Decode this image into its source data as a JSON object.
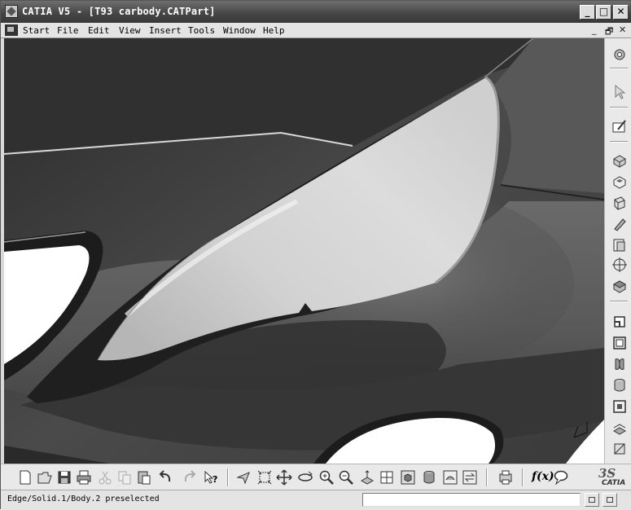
{
  "window": {
    "title": "CATIA V5 - [T93 carbody.CATPart]",
    "controls": {
      "minimize": "_",
      "maximize": "□",
      "close": "✕"
    }
  },
  "menu": {
    "items": [
      {
        "label": "Start",
        "key": "S"
      },
      {
        "label": "File",
        "key": "F"
      },
      {
        "label": "Edit",
        "key": "E"
      },
      {
        "label": "View",
        "key": "V"
      },
      {
        "label": "Insert",
        "key": "I"
      },
      {
        "label": "Tools",
        "key": "T"
      },
      {
        "label": "Window",
        "key": "W"
      },
      {
        "label": "Help",
        "key": "H"
      }
    ],
    "doc_controls": {
      "minimize": "_",
      "restore": "🗗",
      "close": "✕"
    }
  },
  "right_toolbar": {
    "icons": [
      "sketcher-settings-icon",
      "select-arrow-icon",
      "sketcher-icon",
      "pad-icon",
      "pocket-icon",
      "shaft-icon",
      "rib-icon",
      "hole-icon",
      "stiffener-icon",
      "fillet-icon",
      "chamfer-icon",
      "draft-icon",
      "shell-icon",
      "mirror-icon",
      "pattern-icon",
      "thickness-icon",
      "boolean-icon",
      "measure-icon"
    ]
  },
  "bottom_toolbar": {
    "icons": [
      "new-icon",
      "open-icon",
      "save-icon",
      "print-icon",
      "cut-icon",
      "copy-icon",
      "paste-icon",
      "undo-icon",
      "redo-icon",
      "whats-this-icon",
      "fly-mode-icon",
      "fit-all-icon",
      "pan-icon",
      "rotate-icon",
      "zoom-in-icon",
      "zoom-out-icon",
      "normal-view-icon",
      "multi-view-icon",
      "iso-view-icon",
      "shading-icon",
      "hide-show-icon",
      "swap-space-icon",
      "update-icon",
      "formula-icon",
      "comment-icon"
    ],
    "formula_label": "f(x)",
    "logo": {
      "mark": "3S",
      "text": "CATIA"
    }
  },
  "status": {
    "text": "Edge/Solid.1/Body.2 preselected",
    "command_value": ""
  },
  "colors": {
    "titlebar": "#4a4a4a",
    "viewport_bg": "#3d3d3d",
    "toolbar_bg": "#e9e9e9"
  }
}
